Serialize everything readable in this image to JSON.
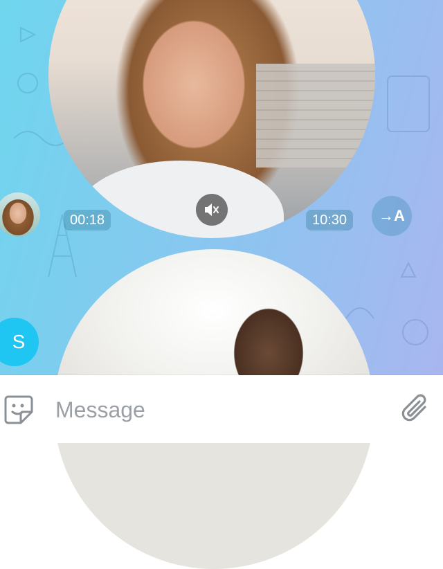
{
  "chat": {
    "video1": {
      "duration": "00:18",
      "sent_time": "10:30"
    },
    "translate_label": "→A",
    "avatar_letter": "S"
  },
  "composer": {
    "placeholder": "Message"
  },
  "icons": {
    "mute": "speaker-muted-icon",
    "sticker": "sticker-icon",
    "attach": "paperclip-icon"
  },
  "colors": {
    "accent": "#1fc6f2",
    "icon_gray": "#8a9096"
  }
}
